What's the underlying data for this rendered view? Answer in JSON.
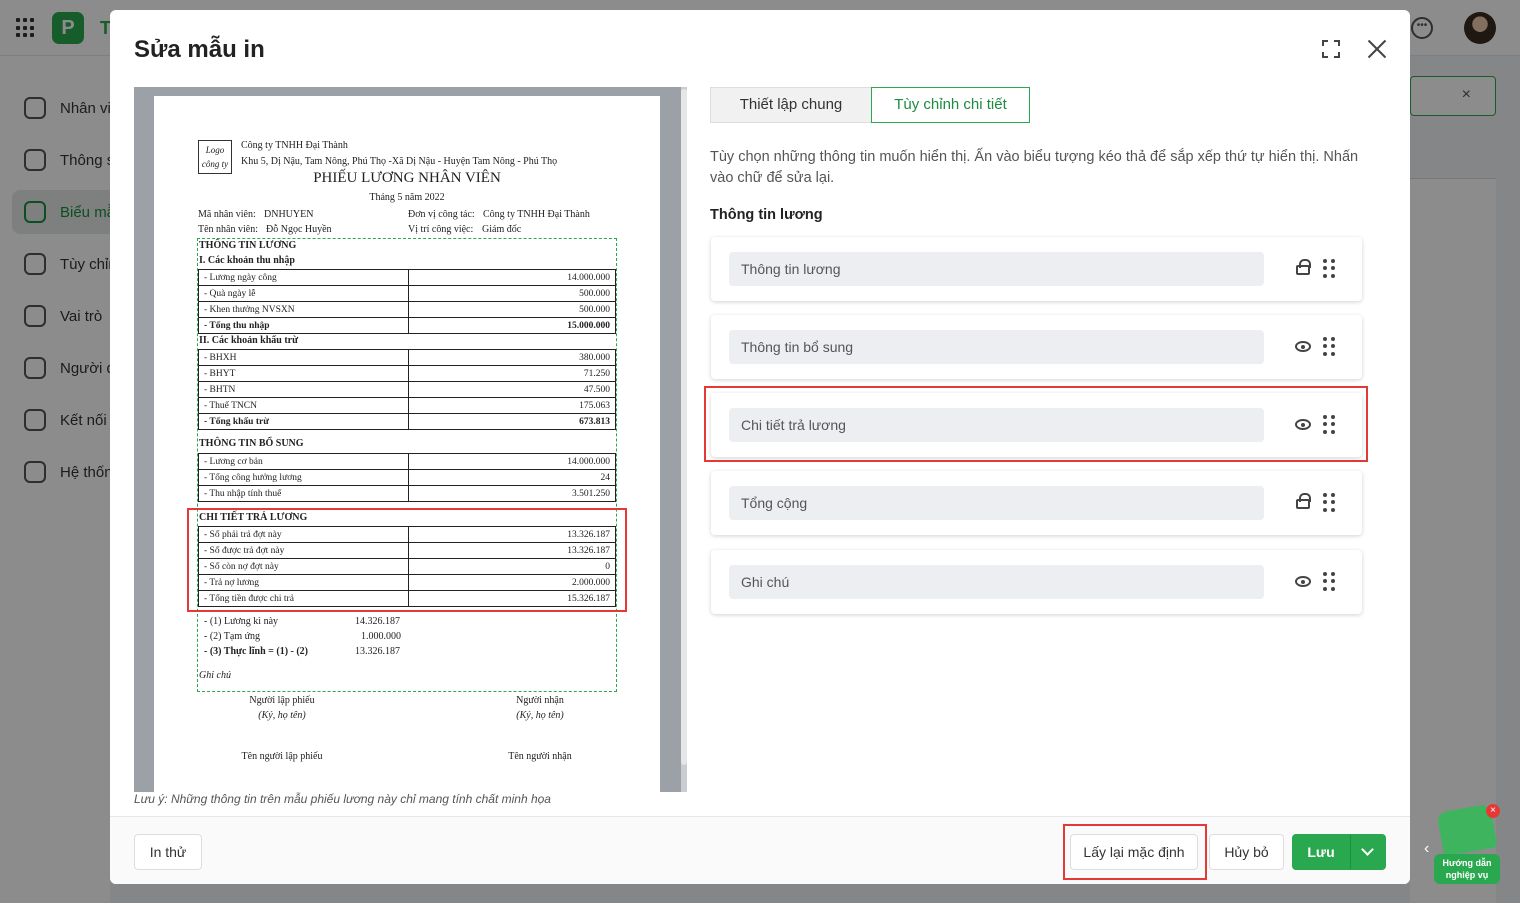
{
  "app": {
    "logo_letter": "P",
    "brand_letter": "T",
    "sidebar": [
      {
        "label": "Nhân viên",
        "icon": "users-icon"
      },
      {
        "label": "Thông số",
        "icon": "sliders-icon"
      },
      {
        "label": "Biểu mẫu",
        "icon": "form-icon",
        "active": true
      },
      {
        "label": "Tùy chỉnh",
        "icon": "tools-icon"
      },
      {
        "label": "Vai trò",
        "icon": "shield-icon"
      },
      {
        "label": "Người dùng",
        "icon": "user-icon"
      },
      {
        "label": "Kết nối",
        "icon": "share-icon"
      },
      {
        "label": "Hệ thống",
        "icon": "monitor-icon"
      }
    ],
    "close_x": "×",
    "helper": {
      "label": "Hướng dẫn nghiệp vụ",
      "close": "×"
    },
    "pager_prev": "‹"
  },
  "modal": {
    "title": "Sửa mẫu in",
    "note": "Lưu ý: Những thông tin trên mẫu phiếu lương này chỉ mang tính chất minh họa",
    "tabs": [
      {
        "label": "Thiết lập chung",
        "active": false
      },
      {
        "label": "Tùy chỉnh chi tiết",
        "active": true
      }
    ],
    "description": "Tùy chọn những thông tin muốn hiển thị. Ấn vào biểu tượng kéo thả để sắp xếp thứ tự hiển thị. Nhấn vào chữ để sửa lại.",
    "section_title": "Thông tin lương",
    "fields": [
      {
        "label": "Thông tin lương",
        "icon": "lock-icon"
      },
      {
        "label": "Thông tin bổ sung",
        "icon": "eye-icon"
      },
      {
        "label": "Chi tiết trả lương",
        "icon": "eye-icon"
      },
      {
        "label": "Tổng cộng",
        "icon": "lock-icon"
      },
      {
        "label": "Ghi chú",
        "icon": "eye-icon"
      }
    ],
    "footer": {
      "print": "In thử",
      "reset": "Lấy lại mặc định",
      "cancel": "Hủy bỏ",
      "save": "Lưu"
    }
  },
  "payslip": {
    "logo": "Logo công ty",
    "company": "Công ty TNHH Đại Thành",
    "address": "Khu 5, Dị Nậu, Tam Nông, Phú Thọ -Xã Dị Nậu - Huyện Tam Nông - Phú Thọ",
    "title": "PHIẾU LƯƠNG NHÂN VIÊN",
    "month": "Tháng 5 năm 2022",
    "employee_code_label": "Mã nhân viên:",
    "employee_code": "DNHUYEN",
    "employee_name_label": "Tên nhân viên:",
    "employee_name": "Đỗ Ngọc Huyền",
    "unit_label": "Đơn vị công tác:",
    "unit": "Công ty TNHH Đại Thành",
    "position_label": "Vị trí công việc:",
    "position": "Giám đốc",
    "salary_info": "THÔNG TIN LƯƠNG",
    "income_title": "I. Các khoản thu nhập",
    "income": [
      {
        "name": "- Lương ngày công",
        "value": "14.000.000"
      },
      {
        "name": "- Quà ngày lễ",
        "value": "500.000"
      },
      {
        "name": "- Khen thưởng NVSXN",
        "value": "500.000"
      },
      {
        "name": "- Tổng thu nhập",
        "value": "15.000.000",
        "bold": true
      }
    ],
    "deduction_title": "II. Các khoản khấu trừ",
    "deductions": [
      {
        "name": "- BHXH",
        "value": "380.000"
      },
      {
        "name": "- BHYT",
        "value": "71.250"
      },
      {
        "name": "- BHTN",
        "value": "47.500"
      },
      {
        "name": "- Thuế TNCN",
        "value": "175.063"
      },
      {
        "name": "- Tổng khấu trừ",
        "value": "673.813",
        "bold": true
      }
    ],
    "extra_title": "THÔNG TIN BỔ SUNG",
    "extra": [
      {
        "name": "- Lương cơ bản",
        "value": "14.000.000"
      },
      {
        "name": "- Tổng công hưởng lương",
        "value": "24"
      },
      {
        "name": "- Thu nhập tính thuế",
        "value": "3.501.250"
      }
    ],
    "payment_title": "CHI TIẾT TRẢ LƯƠNG",
    "payment": [
      {
        "name": "- Số phải trả đợt này",
        "value": "13.326.187"
      },
      {
        "name": "- Số được trả đợt này",
        "value": "13.326.187"
      },
      {
        "name": "- Số còn nợ đợt này",
        "value": "0"
      },
      {
        "name": "- Trả nợ lương",
        "value": "2.000.000"
      },
      {
        "name": "- Tổng tiền được chi trả",
        "value": "15.326.187"
      }
    ],
    "summary": [
      {
        "name": "- (1) Lương kì này",
        "value": "14.326.187"
      },
      {
        "name": "- (2) Tạm ứng",
        "value": "1.000.000"
      },
      {
        "name": "- (3) Thực lĩnh = (1) - (2)",
        "value": "13.326.187",
        "bold": true
      }
    ],
    "note_label": "Ghi chú",
    "preparer": "Người lập phiếu",
    "preparer_sign": "(Ký, họ tên)",
    "preparer_name": "Tên người lập phiếu",
    "receiver": "Người nhận",
    "receiver_sign": "(Ký, họ tên)",
    "receiver_name": "Tên người nhận"
  }
}
